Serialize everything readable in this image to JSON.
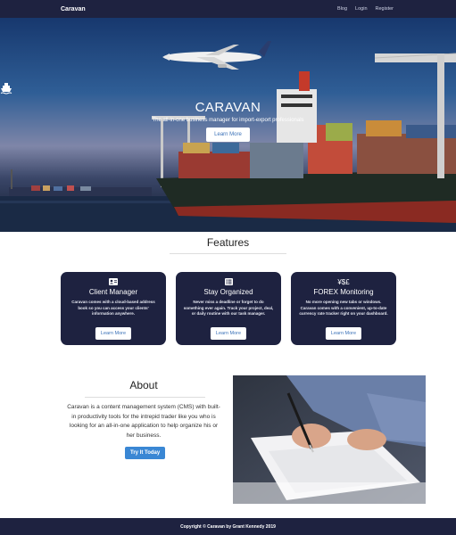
{
  "nav": {
    "brand": "Caravan",
    "links": [
      "Blog",
      "Login",
      "Register"
    ]
  },
  "hero": {
    "icon": "ship-icon",
    "title": "CARAVAN",
    "subtitle": "The all-in-one business manager for import-export professionals",
    "button": "Learn More"
  },
  "features": {
    "title": "Features",
    "cards": [
      {
        "icon": "address-card-icon",
        "title": "Client Manager",
        "text": "Caravan comes with a cloud-based address book so you can access your clients' information anywhere.",
        "button": "Learn More"
      },
      {
        "icon": "task-list-icon",
        "title": "Stay Organized",
        "text": "Never miss a deadline or forget to do something ever again. Track your project, deal, or daily routine with our task manager.",
        "button": "Learn More"
      },
      {
        "icon": "currency-icon",
        "icon_text": "¥$£",
        "title": "FOREX Monitoring",
        "text": "No more opening new tabs or windows. Caravan comes with a convenient, up-to-date currency rate tracker right on your dashboard.",
        "button": "Learn More"
      }
    ]
  },
  "about": {
    "title": "About",
    "text": "Caravan is a content management system (CMS) with built-in productivity tools for the intrepid trader like you who is looking for an all-in-one application to help organize his or her business.",
    "button": "Try It Today"
  },
  "footer": {
    "text": "Copyright © Caravan by Grant Kennedy 2019"
  }
}
